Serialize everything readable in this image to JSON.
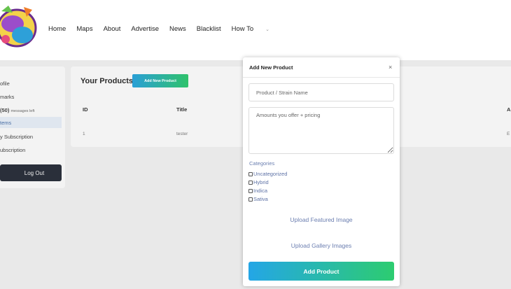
{
  "nav": {
    "items": [
      "Home",
      "Maps",
      "About",
      "Advertise",
      "News",
      "Blacklist",
      "How To"
    ],
    "howto_chevron": "⌄"
  },
  "sidebar": {
    "items": [
      "ofile",
      "marks",
      "(50)",
      "messages left",
      "tems",
      "y Subscription",
      "ubscription"
    ],
    "logout_label": "Log Out"
  },
  "products": {
    "title": "Your Products",
    "add_button_label": "Add New Product",
    "columns": [
      "ID",
      "Title",
      "A"
    ],
    "rows": [
      {
        "id": "1",
        "title": "tester",
        "extra": "E"
      }
    ]
  },
  "modal": {
    "title": "Add New Product",
    "close_label": "×",
    "name_placeholder": "Product / Strain Name",
    "amount_placeholder": "Amounts you offer + pricing",
    "categories_label": "Categories",
    "categories": [
      "Uncategorized",
      "Hybrid",
      "Indica",
      "Sativa"
    ],
    "upload_featured_label": "Upload Featured Image",
    "upload_gallery_label": "Upload Gallery Images",
    "submit_label": "Add Product"
  }
}
